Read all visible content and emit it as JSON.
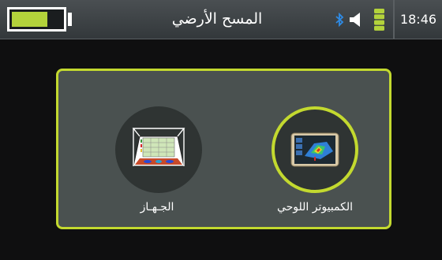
{
  "statusbar": {
    "title": "المسح الأرضي",
    "time": "18:46",
    "battery_level": 0.72,
    "icons": [
      "battery-icon",
      "bluetooth-icon",
      "speaker-icon",
      "signal-icon"
    ]
  },
  "tiles": [
    {
      "label": "الجـهـاز",
      "icon": "device-scan-icon"
    },
    {
      "label": "الكمبيوتر اللوحي",
      "icon": "tablet-3d-icon"
    }
  ],
  "colors": {
    "accent": "#c3d92f",
    "battery": "#b3d23b",
    "panel": "#4a5150",
    "background": "#0f0f10"
  }
}
